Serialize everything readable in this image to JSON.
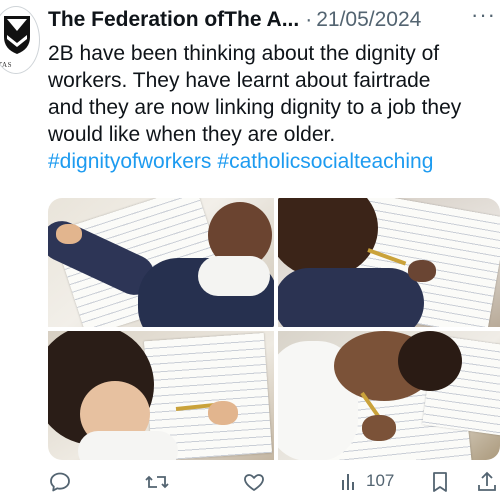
{
  "tweet": {
    "author_name": "The Federation ofThe A...",
    "separator": "·",
    "date": "21/05/2024",
    "more_glyph": "···",
    "avatar_motto": "ITAS",
    "text": "2B have been thinking about the dignity of\nworkers. They have learnt about fairtrade\nand they are now linking dignity to a job they\nwould like when they are older.",
    "hashtags": [
      "#dignityofworkers",
      "#catholicsocialteaching"
    ]
  },
  "media": {
    "photos": [
      {
        "description_icon": "photo-child-writing-1"
      },
      {
        "description_icon": "photo-child-writing-2"
      },
      {
        "description_icon": "photo-child-writing-3"
      },
      {
        "description_icon": "photo-child-writing-4"
      }
    ]
  },
  "actions": {
    "reply_icon": "reply-icon",
    "retweet_icon": "retweet-icon",
    "like_icon": "like-icon",
    "views_icon": "views-icon",
    "views_count": "107",
    "share_icon": "share-icon"
  },
  "colors": {
    "text": "#0f1419",
    "secondary": "#536471",
    "link": "#1d9bf0"
  }
}
